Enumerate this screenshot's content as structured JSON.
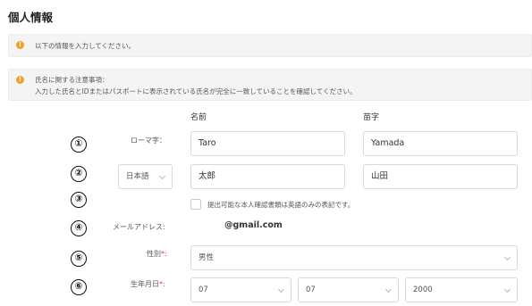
{
  "page_title": "個人情報",
  "notices": {
    "info1": "以下の情報を入力してください。",
    "info2_line1": "氏名に関する注意事項：",
    "info2_line2": "入力した氏名とIDまたはパスポートに表示されている氏名が完全に一致していることを確認してください。"
  },
  "columns": {
    "given_name": "名前",
    "family_name": "苗字"
  },
  "markers": [
    "①",
    "②",
    "③",
    "④",
    "⑤",
    "⑥"
  ],
  "romaji": {
    "label": "ローマ字：",
    "given_value": "Taro",
    "family_value": "Yamada"
  },
  "native": {
    "language_select": "日本語",
    "given_value": "太郎",
    "family_value": "山田"
  },
  "english_only": {
    "checked": false,
    "label": "提出可能な本人確認書類は英語のみの表記です。"
  },
  "email": {
    "label": "メールアドレス:",
    "value": "@gmail.com"
  },
  "gender": {
    "label": "性別",
    "required_mark": "*:",
    "value": "男性"
  },
  "birthdate": {
    "label": "生年月日",
    "required_mark": "*:",
    "month": "07",
    "day": "07",
    "year": "2000"
  },
  "colors": {
    "info_icon": "#f0a020",
    "required": "#e53935",
    "notice_bg": "#f4f4f4"
  }
}
